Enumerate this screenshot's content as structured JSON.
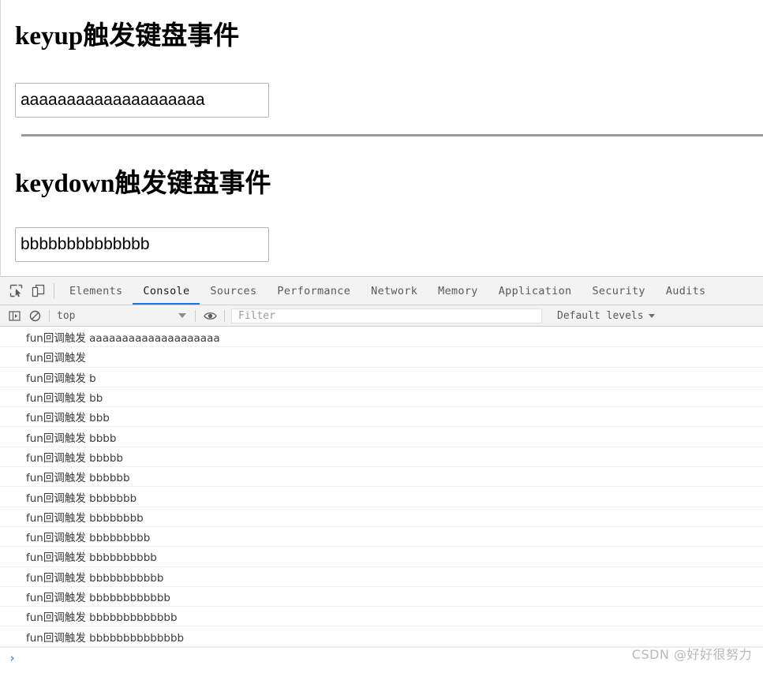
{
  "page": {
    "headings": {
      "keyup": "keyup触发键盘事件",
      "keydown": "keydown触发键盘事件"
    },
    "inputs": {
      "keyup_value": "aaaaaaaaaaaaaaaaaaaa",
      "keydown_value": "bbbbbbbbbbbbbb",
      "placeholder": ""
    }
  },
  "devtools": {
    "toolbar_icons": [
      {
        "name": "inspect-element-icon",
        "title": "Inspect element"
      },
      {
        "name": "device-toolbar-icon",
        "title": "Toggle device toolbar"
      }
    ],
    "tabs": [
      {
        "label": "Elements",
        "active": false
      },
      {
        "label": "Console",
        "active": true
      },
      {
        "label": "Sources",
        "active": false
      },
      {
        "label": "Performance",
        "active": false
      },
      {
        "label": "Network",
        "active": false
      },
      {
        "label": "Memory",
        "active": false
      },
      {
        "label": "Application",
        "active": false
      },
      {
        "label": "Security",
        "active": false
      },
      {
        "label": "Audits",
        "active": false
      }
    ],
    "filter_bar": {
      "sidebar_toggle_icon": "console-sidebar-icon",
      "clear_icon": "clear-console-icon",
      "context_value": "top",
      "eye_icon": "live-expression-icon",
      "filter_placeholder": "Filter",
      "levels_label": "Default levels"
    },
    "accent_color": "#1a73e8",
    "prompt_symbol": "›",
    "log_rows": [
      "fun回调触发 aaaaaaaaaaaaaaaaaaaa",
      "fun回调触发 ",
      "fun回调触发 b",
      "fun回调触发 bb",
      "fun回调触发 bbb",
      "fun回调触发 bbbb",
      "fun回调触发 bbbbb",
      "fun回调触发 bbbbbb",
      "fun回调触发 bbbbbbb",
      "fun回调触发 bbbbbbbb",
      "fun回调触发 bbbbbbbbb",
      "fun回调触发 bbbbbbbbbb",
      "fun回调触发 bbbbbbbbbbb",
      "fun回调触发 bbbbbbbbbbbb",
      "fun回调触发 bbbbbbbbbbbbb",
      "fun回调触发 bbbbbbbbbbbbbb"
    ]
  },
  "watermark": "CSDN @好好很努力"
}
